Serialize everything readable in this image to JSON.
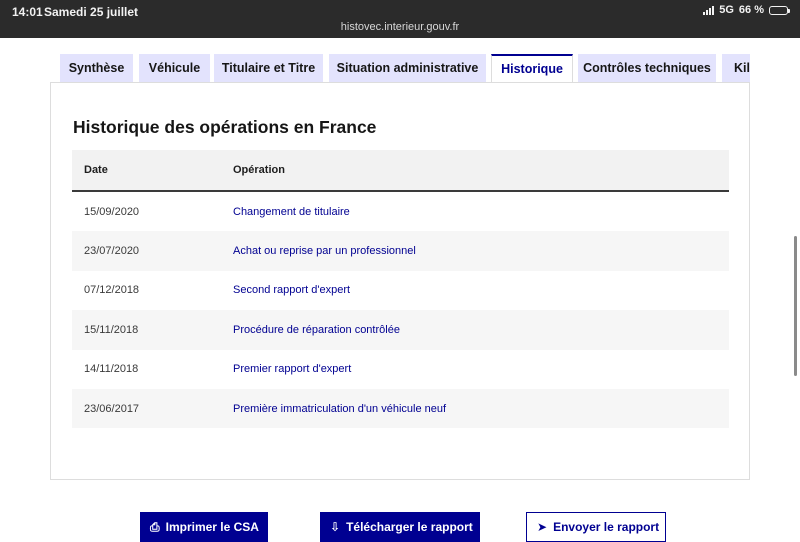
{
  "status_bar": {
    "time": "14:01",
    "date": "Samedi 25 juillet",
    "url": "histovec.interieur.gouv.fr",
    "network": "5G",
    "battery": "66 %",
    "battery_level": 0.66
  },
  "tabs": [
    {
      "label": "Synthèse",
      "active": false
    },
    {
      "label": "Véhicule",
      "active": false
    },
    {
      "label": "Titulaire et Titre",
      "active": false
    },
    {
      "label": "Situation administrative",
      "active": false
    },
    {
      "label": "Historique",
      "active": true
    },
    {
      "label": "Contrôles techniques",
      "active": false
    },
    {
      "label": "Kilométrage",
      "active": false
    }
  ],
  "section": {
    "title": "Historique des opérations en France"
  },
  "table": {
    "headers": {
      "date": "Date",
      "operation": "Opération"
    },
    "rows": [
      {
        "date": "15/09/2020",
        "operation": "Changement de titulaire"
      },
      {
        "date": "23/07/2020",
        "operation": "Achat ou reprise par un professionnel"
      },
      {
        "date": "07/12/2018",
        "operation": "Second rapport d'expert"
      },
      {
        "date": "15/11/2018",
        "operation": "Procédure de réparation contrôlée"
      },
      {
        "date": "14/11/2018",
        "operation": "Premier rapport d'expert"
      },
      {
        "date": "23/06/2017",
        "operation": "Première immatriculation d'un véhicule neuf"
      }
    ]
  },
  "buttons": {
    "print": "Imprimer le CSA",
    "download": "Télécharger le rapport",
    "send": "Envoyer le rapport"
  },
  "colors": {
    "accent": "#000091",
    "tab_bg": "#e3e3fd",
    "status_bar_bg": "#2b2b2b"
  }
}
